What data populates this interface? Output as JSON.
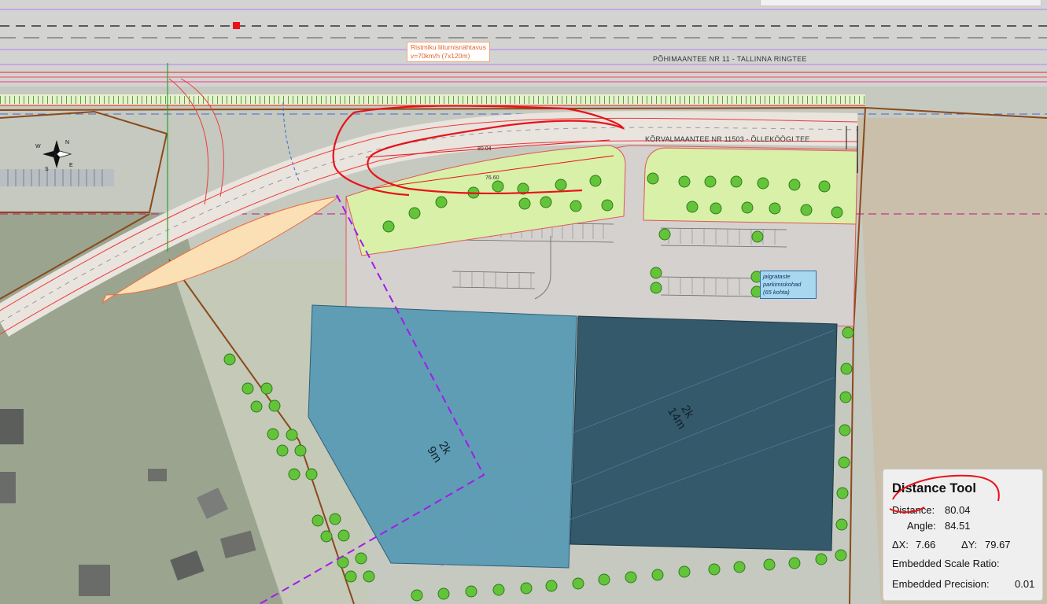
{
  "map": {
    "road_main_label": "PÕHIMAANTEE NR 11 - TALLINNA RINGTEE",
    "road_side_label": "KÕRVALMAANTEE NR 11503 - ÕLLEKÖÖGI TEE",
    "speed_line1": "Ristmiku liiturnisnähtavus",
    "speed_line2": "v=70km/h (7x120m)",
    "bike_line1": "jalgrataste",
    "bike_line2": "parkimiskohad",
    "bike_line3": "(65 kohta)",
    "measure_1": "80.04",
    "measure_2": "76.60",
    "building_left_line1": "2k",
    "building_left_line2": "9m",
    "building_right_line1": "2k",
    "building_right_line2": "14m",
    "compass_icon": "compass-rose-icon",
    "colors": {
      "building_left": "#5f9db5",
      "building_right": "#33596a",
      "grass": "#d9f0a8",
      "parking": "#d4d1cf",
      "boundary": "#8a4a1a",
      "annotation_red": "#e8121b",
      "purple_line": "#a21bea"
    }
  },
  "tool": {
    "title": "Distance Tool",
    "distance_label": "Distance:",
    "distance_value": "80.04",
    "angle_label": "Angle:",
    "angle_value": "84.51",
    "dx_label": "ΔX:",
    "dx_value": "7.66",
    "dy_label": "ΔY:",
    "dy_value": "79.67",
    "scale_label": "Embedded Scale Ratio:",
    "precision_label": "Embedded Precision:",
    "precision_value": "0.01"
  }
}
